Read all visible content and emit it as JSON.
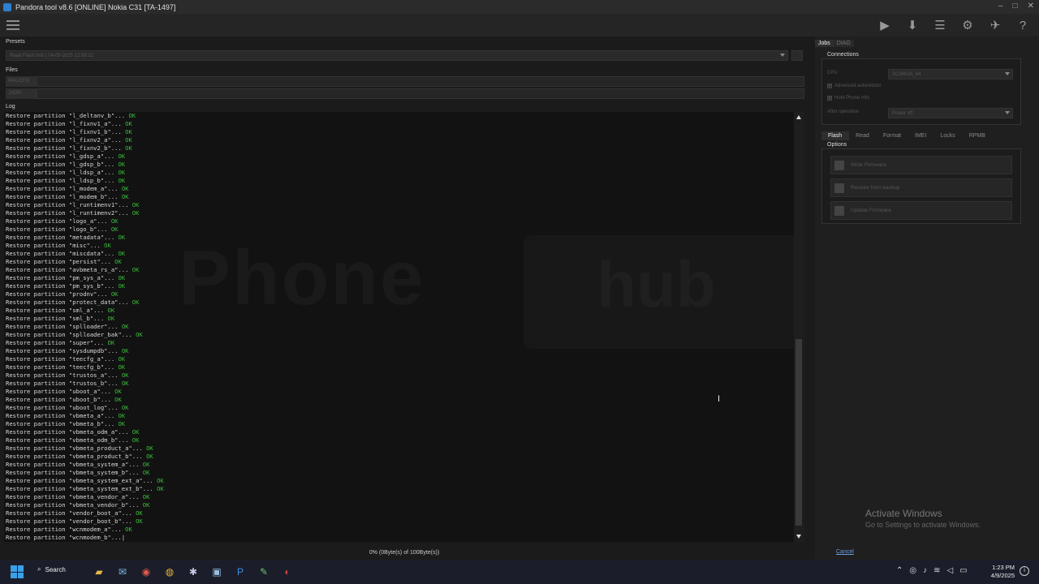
{
  "window": {
    "title": "Pandora tool v8.6 [ONLINE] Nokia C31 [TA-1497]",
    "controls": [
      "–",
      "□",
      "✕"
    ]
  },
  "toolbar": {
    "icons": [
      "play-icon",
      "download-icon",
      "list-icon",
      "gear-icon",
      "telegram-icon",
      "help-icon"
    ],
    "glyphs": [
      "▶",
      "⬇",
      "☰",
      "⚙",
      "✈",
      "?"
    ]
  },
  "presets": {
    "label": "Presets",
    "value": "Read Flash Info | 04-09-2025 12:59:12"
  },
  "files": {
    "label": "Files",
    "rows": [
      {
        "label": "PAC/CFG",
        "value": ""
      },
      {
        "label": "JSON",
        "value": ""
      }
    ]
  },
  "log": {
    "label": "Log",
    "lines": [
      {
        "text": "Restore partition \"l_deltanv_b\"... ",
        "status": "OK"
      },
      {
        "text": "Restore partition \"l_fixnv1_a\"... ",
        "status": "OK"
      },
      {
        "text": "Restore partition \"l_fixnv1_b\"... ",
        "status": "OK"
      },
      {
        "text": "Restore partition \"l_fixnv2_a\"... ",
        "status": "OK"
      },
      {
        "text": "Restore partition \"l_fixnv2_b\"... ",
        "status": "OK"
      },
      {
        "text": "Restore partition \"l_gdsp_a\"... ",
        "status": "OK"
      },
      {
        "text": "Restore partition \"l_gdsp_b\"... ",
        "status": "OK"
      },
      {
        "text": "Restore partition \"l_ldsp_a\"... ",
        "status": "OK"
      },
      {
        "text": "Restore partition \"l_ldsp_b\"... ",
        "status": "OK"
      },
      {
        "text": "Restore partition \"l_modem_a\"... ",
        "status": "OK"
      },
      {
        "text": "Restore partition \"l_modem_b\"... ",
        "status": "OK"
      },
      {
        "text": "Restore partition \"l_runtimenv1\"... ",
        "status": "OK"
      },
      {
        "text": "Restore partition \"l_runtimenv2\"... ",
        "status": "OK"
      },
      {
        "text": "Restore partition \"logo_a\"... ",
        "status": "OK"
      },
      {
        "text": "Restore partition \"logo_b\"... ",
        "status": "OK"
      },
      {
        "text": "Restore partition \"metadata\"... ",
        "status": "OK"
      },
      {
        "text": "Restore partition \"misc\"... ",
        "status": "OK"
      },
      {
        "text": "Restore partition \"miscdata\"... ",
        "status": "OK"
      },
      {
        "text": "Restore partition \"persist\"... ",
        "status": "OK"
      },
      {
        "text": "Restore partition \"avbmeta_rs_a\"... ",
        "status": "OK"
      },
      {
        "text": "Restore partition \"pm_sys_a\"... ",
        "status": "OK"
      },
      {
        "text": "Restore partition \"pm_sys_b\"... ",
        "status": "OK"
      },
      {
        "text": "Restore partition \"prodnv\"... ",
        "status": "OK"
      },
      {
        "text": "Restore partition \"protect_data\"... ",
        "status": "OK"
      },
      {
        "text": "Restore partition \"sml_a\"... ",
        "status": "OK"
      },
      {
        "text": "Restore partition \"sml_b\"... ",
        "status": "OK"
      },
      {
        "text": "Restore partition \"splloader\"... ",
        "status": "OK"
      },
      {
        "text": "Restore partition \"splloader_bak\"... ",
        "status": "OK"
      },
      {
        "text": "Restore partition \"super\"... ",
        "status": "OK"
      },
      {
        "text": "Restore partition \"sysdumpdb\"... ",
        "status": "OK"
      },
      {
        "text": "Restore partition \"teecfg_a\"... ",
        "status": "OK"
      },
      {
        "text": "Restore partition \"teecfg_b\"... ",
        "status": "OK"
      },
      {
        "text": "Restore partition \"trustos_a\"... ",
        "status": "OK"
      },
      {
        "text": "Restore partition \"trustos_b\"... ",
        "status": "OK"
      },
      {
        "text": "Restore partition \"uboot_a\"... ",
        "status": "OK"
      },
      {
        "text": "Restore partition \"uboot_b\"... ",
        "status": "OK"
      },
      {
        "text": "Restore partition \"uboot_log\"... ",
        "status": "OK"
      },
      {
        "text": "Restore partition \"vbmeta_a\"... ",
        "status": "OK"
      },
      {
        "text": "Restore partition \"vbmeta_b\"... ",
        "status": "OK"
      },
      {
        "text": "Restore partition \"vbmeta_odm_a\"... ",
        "status": "OK"
      },
      {
        "text": "Restore partition \"vbmeta_odm_b\"... ",
        "status": "OK"
      },
      {
        "text": "Restore partition \"vbmeta_product_a\"... ",
        "status": "OK"
      },
      {
        "text": "Restore partition \"vbmeta_product_b\"... ",
        "status": "OK"
      },
      {
        "text": "Restore partition \"vbmeta_system_a\"... ",
        "status": "OK"
      },
      {
        "text": "Restore partition \"vbmeta_system_b\"... ",
        "status": "OK"
      },
      {
        "text": "Restore partition \"vbmeta_system_ext_a\"... ",
        "status": "OK"
      },
      {
        "text": "Restore partition \"vbmeta_system_ext_b\"... ",
        "status": "OK"
      },
      {
        "text": "Restore partition \"vbmeta_vendor_a\"... ",
        "status": "OK"
      },
      {
        "text": "Restore partition \"vbmeta_vendor_b\"... ",
        "status": "OK"
      },
      {
        "text": "Restore partition \"vendor_boot_a\"... ",
        "status": "OK"
      },
      {
        "text": "Restore partition \"vendor_boot_b\"... ",
        "status": "OK"
      },
      {
        "text": "Restore partition \"wcnmodem_a\"... ",
        "status": "OK"
      },
      {
        "text": "Restore partition \"wcnmodem_b\"...|",
        "status": ""
      }
    ]
  },
  "progress": {
    "text": "0% (0Byte(s) of 100Byte(s))"
  },
  "right": {
    "tabs": [
      "Jobs",
      "DIAG"
    ],
    "connections": {
      "title": "Connections",
      "cpu_label": "CPU",
      "cpu_value": "SC9863A_64",
      "check1": "Advanced autoreboot",
      "check2": "Hold Phone Info",
      "after_label": "After operation",
      "after_value": "Power off"
    },
    "func_tabs": [
      "Flash",
      "Read",
      "Format",
      "IMEI",
      "Locks",
      "RPMB"
    ],
    "options": {
      "title": "Options",
      "buttons": [
        "Write Firmware",
        "Restore from backup",
        "Update Firmware"
      ]
    },
    "cancel": "Cancel"
  },
  "watermark": {
    "word": "Phone",
    "suffix": "hub"
  },
  "activation": {
    "line1": "Activate Windows",
    "line2": "Go to Settings to activate Windows."
  },
  "taskbar": {
    "search": "Search",
    "time": "1:23 PM",
    "date": "4/9/2025"
  }
}
